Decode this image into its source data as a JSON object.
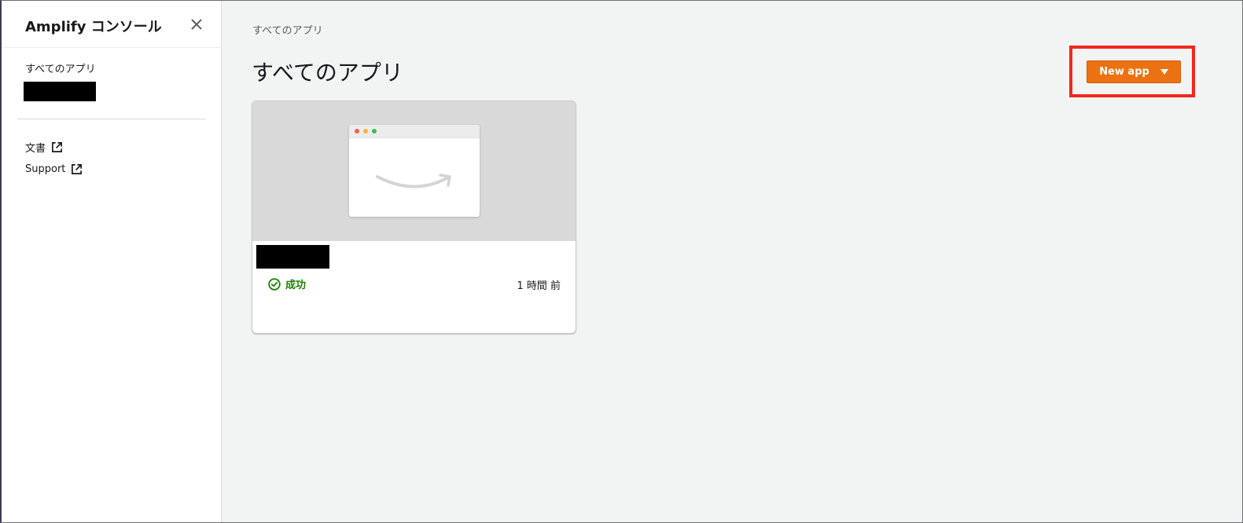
{
  "sidebar": {
    "title": "Amplify コンソール",
    "nav_all_apps": "すべてのアプリ",
    "links": [
      {
        "label": "文書",
        "icon": "external-link-icon"
      },
      {
        "label": "Support",
        "icon": "external-link-icon"
      }
    ]
  },
  "main": {
    "breadcrumb": "すべてのアプリ",
    "title": "すべてのアプリ",
    "new_app_label": "New app",
    "highlight_color": "#f0281c",
    "accent_color": "#ec7211"
  },
  "app_card": {
    "status": "成功",
    "status_color": "#1d8102",
    "updated": "1 時間 前",
    "preview_icon": "amazon-smile-logo"
  }
}
